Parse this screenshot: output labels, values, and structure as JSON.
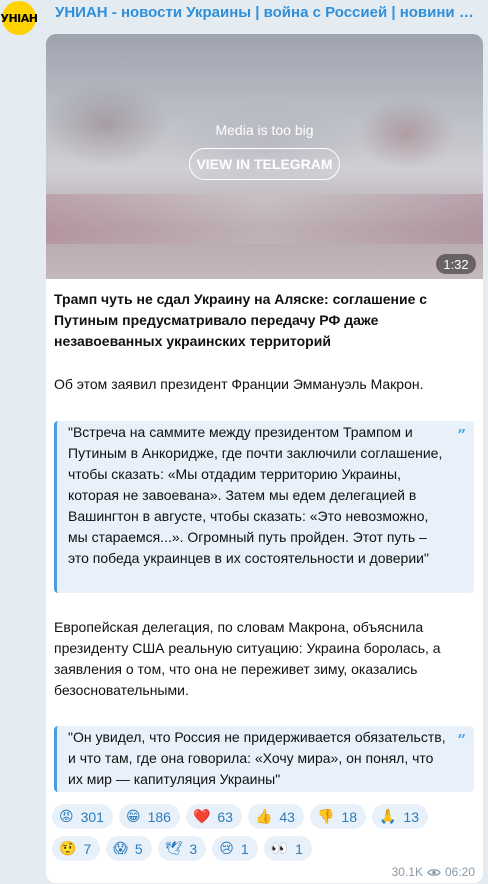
{
  "channel": {
    "avatar_text": "УНІАН",
    "title": "УНИАН - новости Украины | война с Россией | новини Україні..."
  },
  "media": {
    "status_text": "Media is too big",
    "view_button": "VIEW IN TELEGRAM",
    "duration": "1:32"
  },
  "post": {
    "headline": "Трамп чуть не сдал Украину на Аляске: соглашение с Путиным предусматривало передачу РФ даже незавоеванных украинских территорий",
    "paragraph1": "Об этом заявил президент Франции Эммануэль Макрон.",
    "quote1": "\"Встреча на саммите между президентом Трампом и Путиным в Анкоридже, где почти заключили соглашение, чтобы сказать: «Мы отдадим территорию Украины, которая не завоевана». Затем мы едем делегацией в Вашингтон в августе, чтобы сказать: «Это невозможно, мы стараемся...». Огромный путь пройден. Этот путь – это победа украинцев в их состоятельности и доверии\"",
    "paragraph2": "Европейская делегация, по словам Макрона, объяснила президенту США реальную ситуацию: Украина боролась, а заявления о том, что она не переживет зиму, оказались безосновательными.",
    "quote2": "\"Он увидел, что Россия не придерживается обязательств, и что там, где она говорила: «Хочу мира», он понял, что их мир — капитуляция Украины\"",
    "quote_mark": "”"
  },
  "reactions": {
    "row1": [
      {
        "emoji": "😡",
        "count": "301"
      },
      {
        "emoji": "😁",
        "count": "186"
      },
      {
        "emoji": "❤️",
        "count": "63"
      },
      {
        "emoji": "👍",
        "count": "43"
      },
      {
        "emoji": "👎",
        "count": "18"
      },
      {
        "emoji": "🙏",
        "count": "13"
      }
    ],
    "row2": [
      {
        "emoji": "🤨",
        "count": "7"
      },
      {
        "emoji": "😱",
        "count": "5"
      },
      {
        "emoji": "🕊",
        "count": "3"
      },
      {
        "emoji": "😢",
        "count": "1"
      },
      {
        "emoji": "👀",
        "count": "1"
      }
    ]
  },
  "meta": {
    "views": "30.1K",
    "time": "06:20"
  }
}
